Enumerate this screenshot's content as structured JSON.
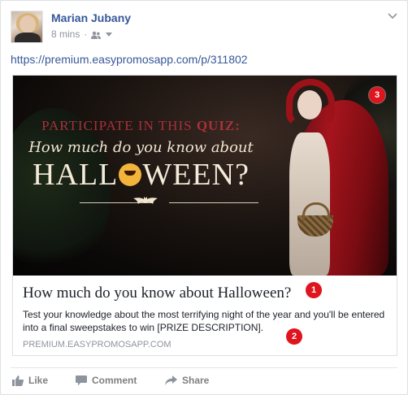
{
  "post": {
    "author": "Marian Jubany",
    "time": "8 mins",
    "audience_icon": "friends-icon",
    "link_url": "https://premium.easypromosapp.com/p/311802"
  },
  "preview": {
    "hero": {
      "line1_prefix": "Participate in this",
      "line1_highlight": "Quiz:",
      "line2": "How much do you know about",
      "line3_prefix": "HALL",
      "line3_suffix": "WEEN?"
    },
    "title": "How much do you know about Halloween?",
    "description": "Test your knowledge about the most terrifying night of the year and you'll be entered into a final sweepstakes to win [PRIZE DESCRIPTION].",
    "domain": "PREMIUM.EASYPROMOSAPP.COM"
  },
  "badges": [
    "1",
    "2",
    "3"
  ],
  "actions": {
    "like": "Like",
    "comment": "Comment",
    "share": "Share"
  },
  "colors": {
    "link": "#365899",
    "badge": "#e0141d",
    "muted": "#90949c"
  }
}
